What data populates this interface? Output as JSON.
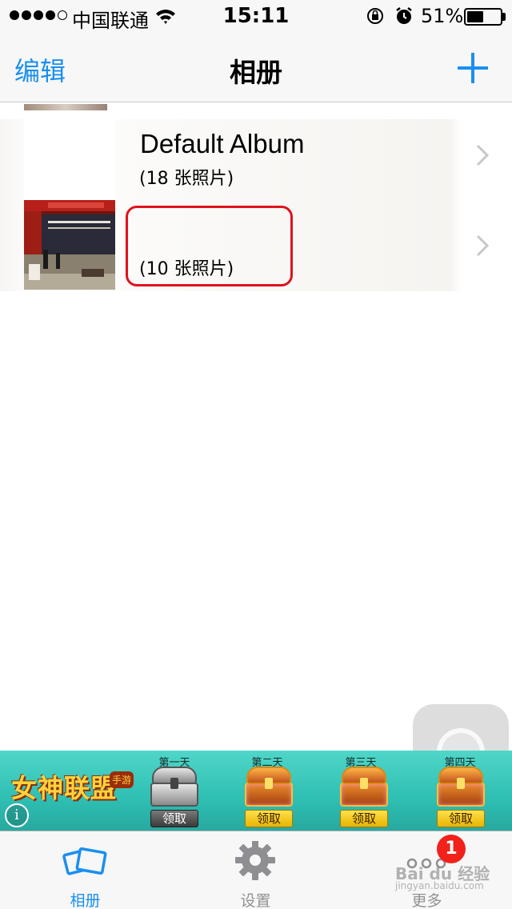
{
  "status_bar": {
    "carrier": "中国联通",
    "time": "15:11",
    "battery_percent": "51%",
    "battery_level": 0.51,
    "signal_bars_filled": 4,
    "signal_bars_total": 5,
    "icons": [
      "signal-dots",
      "wifi-icon",
      "rotation-lock-icon",
      "alarm-icon",
      "battery-icon"
    ]
  },
  "nav": {
    "edit_label": "编辑",
    "title": "相册",
    "add_icon": "plus-icon",
    "accent_color": "#1a8ff0"
  },
  "albums": [
    {
      "name": "Default Album",
      "count_label": "(18 张照片)"
    },
    {
      "name": "",
      "count_label": "(10 张照片)"
    }
  ],
  "annotation": {
    "highlight_color": "#e0121c"
  },
  "ad": {
    "logo_text": "女神联盟",
    "logo_tag": "手游",
    "info_icon": "i",
    "days": [
      {
        "label": "第一天",
        "chest": "silver",
        "button": "领取"
      },
      {
        "label": "第二天",
        "chest": "gold",
        "button": "领取"
      },
      {
        "label": "第三天",
        "chest": "gold",
        "button": "领取"
      },
      {
        "label": "第四天",
        "chest": "gold",
        "button": "领取"
      }
    ]
  },
  "tab_bar": {
    "tabs": [
      {
        "label": "相册",
        "icon": "photo-album-icon",
        "active": true
      },
      {
        "label": "设置",
        "icon": "gear-icon",
        "active": false
      },
      {
        "label": "更多",
        "icon": "more-dots-icon",
        "active": false
      }
    ],
    "badge": "1"
  },
  "watermark": {
    "text": "Bai du 经验",
    "sub": "jingyan.baidu.com"
  }
}
